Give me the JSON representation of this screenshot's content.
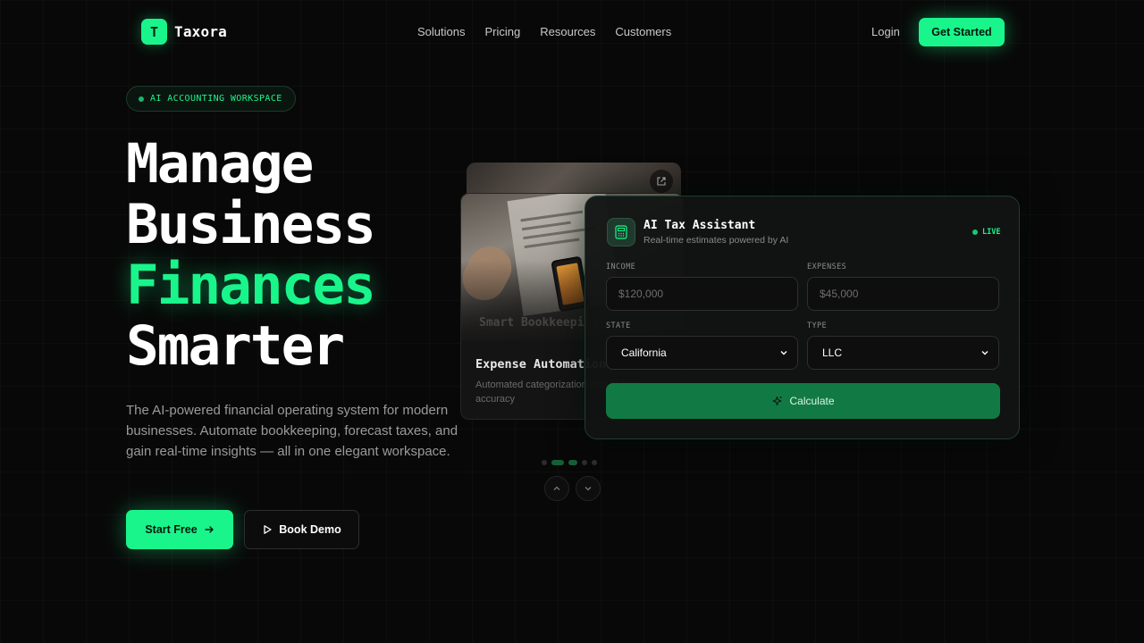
{
  "brand": {
    "mark": "T",
    "name": "Taxora"
  },
  "nav": {
    "links": [
      "Solutions",
      "Pricing",
      "Resources",
      "Customers"
    ],
    "login": "Login",
    "cta": "Get Started"
  },
  "hero": {
    "badge": "AI ACCOUNTING WORKSPACE",
    "headline": [
      "Manage",
      "Business",
      "Finances",
      "Smarter"
    ],
    "description": "The AI-powered financial operating system for modern businesses. Automate bookkeeping, forecast taxes, and gain real-time insights — all in one elegant workspace.",
    "primary_button": "Start Free",
    "secondary_button": "Book Demo"
  },
  "feature_card": {
    "ghost_title": "Smart Bookkeeping",
    "title": "Expense Automation",
    "description": "Automated categorization with AI-level accuracy"
  },
  "ai_panel": {
    "title": "AI Tax Assistant",
    "subtitle": "Real-time estimates powered by AI",
    "status": "LIVE",
    "income_label": "INCOME",
    "income_placeholder": "$120,000",
    "expenses_label": "EXPENSES",
    "expenses_placeholder": "$45,000",
    "state_label": "STATE",
    "state_value": "California",
    "type_label": "TYPE",
    "type_value": "LLC",
    "calculate": "Calculate"
  },
  "colors": {
    "accent": "#19f58b",
    "background": "#080808",
    "button_dark_green": "#117a44"
  },
  "icons": [
    "external-link-icon",
    "calculator-icon",
    "sparkle-icon",
    "arrow-right-icon",
    "play-icon",
    "chevron-up-icon",
    "chevron-down-icon"
  ]
}
